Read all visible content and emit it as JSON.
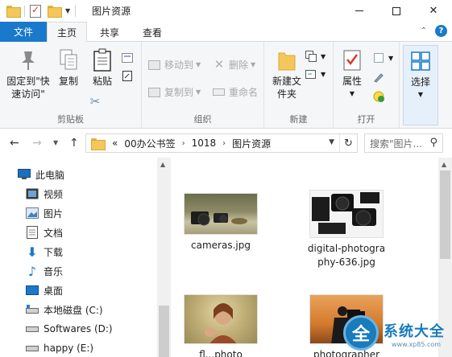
{
  "window": {
    "title": "图片资源",
    "minimize": "—",
    "close": "✕"
  },
  "tabs": {
    "file": "文件",
    "home": "主页",
    "share": "共享",
    "view": "查看",
    "help": "?"
  },
  "ribbon": {
    "clipboard": {
      "pin": "固定到\"快速访问\"",
      "copy": "复制",
      "paste": "粘贴",
      "label": "剪贴板"
    },
    "organize": {
      "move_to": "移动到",
      "copy_to": "复制到",
      "delete": "删除",
      "rename": "重命名",
      "label": "组织"
    },
    "new": {
      "new_folder": "新建文件夹",
      "label": "新建"
    },
    "open": {
      "properties": "属性",
      "label": "打开"
    },
    "select": {
      "select": "选择"
    }
  },
  "address": {
    "overflow": "«",
    "crumbs": [
      "00办公书签",
      "1018",
      "图片资源"
    ],
    "search_placeholder": "搜索\"图片..."
  },
  "sidebar": {
    "this_pc": "此电脑",
    "items": [
      "视频",
      "图片",
      "文档",
      "下载",
      "音乐",
      "桌面",
      "本地磁盘 (C:)",
      "Softwares (D:)",
      "happy (E:)"
    ]
  },
  "files": [
    {
      "name": "cameras.jpg"
    },
    {
      "name": "digital-photography-636.jpg"
    },
    {
      "name": "fl...photo"
    },
    {
      "name": "photographer"
    }
  ],
  "watermark": {
    "logo_char": "全",
    "text": "系统大全",
    "url": "www.xp85.com"
  },
  "colors": {
    "accent": "#1979ca",
    "ribbon_bg": "#f5f6f7",
    "folder": "#f4c75a"
  }
}
